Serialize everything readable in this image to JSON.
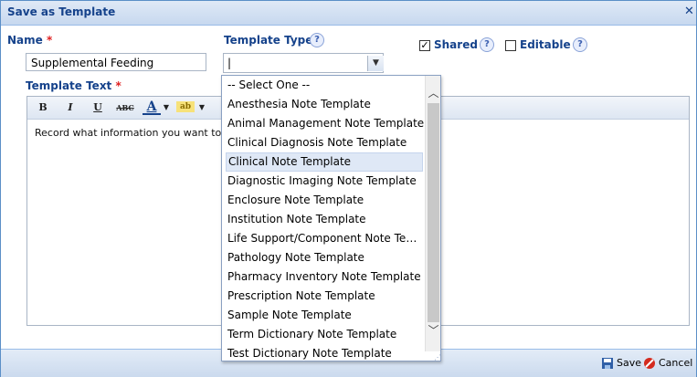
{
  "dialog": {
    "title": "Save as Template",
    "close_glyph": "✕"
  },
  "name_field": {
    "label": "Name",
    "required_mark": "*",
    "value": "Supplemental Feeding"
  },
  "template_type": {
    "label": "Template Type",
    "value": "|"
  },
  "shared": {
    "label": "Shared",
    "checked": true,
    "check_glyph": "✓"
  },
  "editable": {
    "label": "Editable",
    "checked": false
  },
  "template_text": {
    "label": "Template Text",
    "required_mark": "*",
    "content": "Record what information you want to",
    "toolbar": {
      "bold": "B",
      "italic": "I",
      "underline": "U",
      "strike": "ABC",
      "font_color": "A",
      "highlight": "ab",
      "caret": "▼"
    }
  },
  "dropdown": {
    "options": [
      "-- Select One --",
      "Anesthesia Note Template",
      "Animal Management Note Template",
      "Clinical Diagnosis Note Template",
      "Clinical Note Template",
      "Diagnostic Imaging Note Template",
      "Enclosure Note Template",
      "Institution Note Template",
      "Life Support/Component Note Templa...",
      "Pathology Note Template",
      "Pharmacy Inventory Note Template",
      "Prescription Note Template",
      "Sample Note Template",
      "Term Dictionary Note Template",
      "Test Dictionary Note Template"
    ],
    "selected_index": 4
  },
  "footer": {
    "save_label": "Save",
    "cancel_label": "Cancel"
  },
  "colors": {
    "accent": "#15428b",
    "required": "#e02020",
    "titlebar": "#c7d8ef",
    "selected_row": "#dfe8f6"
  },
  "icons": {
    "help": "question-help-icon",
    "save": "floppy-disk-icon",
    "cancel": "cancel-circle-icon",
    "close": "close-icon"
  }
}
